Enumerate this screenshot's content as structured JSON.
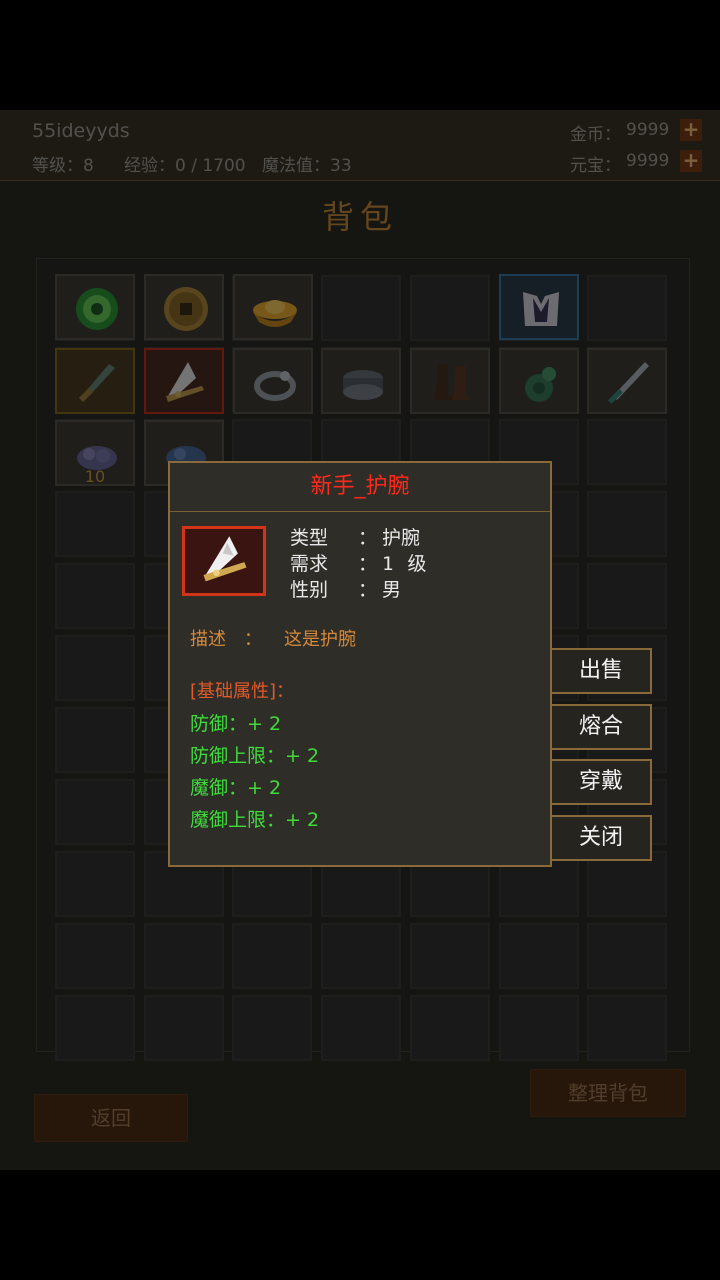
{
  "player": {
    "name": "55ideyyds",
    "level_label": "等级：8",
    "exp_label": "经验：0 / 1700",
    "mana_label": "魔法值：33",
    "gold_label": "金币：",
    "gold_value": "9999",
    "ingot_label": "元宝：",
    "ingot_value": "9999",
    "plus": "+"
  },
  "bag": {
    "title": "背包",
    "slots": [
      {
        "icon": "jade-coin-icon",
        "quality": "normal"
      },
      {
        "icon": "copper-coin-icon",
        "quality": "normal"
      },
      {
        "icon": "gold-ingot-icon",
        "quality": "normal"
      },
      {
        "icon": "robe-armor-icon",
        "quality": "blue"
      },
      {
        "icon": "dagger-icon",
        "quality": "gold"
      },
      {
        "icon": "bracer-icon",
        "quality": "red"
      },
      {
        "icon": "ring-icon",
        "quality": "normal"
      },
      {
        "icon": "belt-icon",
        "quality": "normal"
      },
      {
        "icon": "boots-icon",
        "quality": "normal"
      },
      {
        "icon": "pouch-icon",
        "quality": "normal"
      },
      {
        "icon": "sword-icon",
        "quality": "normal"
      },
      {
        "icon": "ore-icon",
        "quality": "normal",
        "count": "10"
      },
      {
        "icon": "ore-blue-icon",
        "quality": "normal"
      }
    ],
    "back_button": "返回",
    "sort_button": "整理背包"
  },
  "item_popup": {
    "title": "新手_护腕",
    "type_key": "类型",
    "type_value": "护腕",
    "req_key": "需求",
    "req_value": "1",
    "req_unit": "级",
    "gender_key": "性别",
    "gender_value": "男",
    "colon": "：",
    "desc_key": "描述",
    "desc_value": "这是护腕",
    "attr_title": "[基础属性]：",
    "attrs": [
      "防御：+ 2",
      "防御上限：+ 2",
      "魔御：+ 2",
      "魔御上限：+ 2"
    ]
  },
  "actions": {
    "sell": "出售",
    "fuse": "熔合",
    "equip": "穿戴",
    "close": "关闭"
  },
  "colors": {
    "popup_title": "#ff2a1a",
    "attr_green": "#3edc3a",
    "desc_orange": "#d58a3a",
    "frame_gold": "#8a6a3a"
  }
}
